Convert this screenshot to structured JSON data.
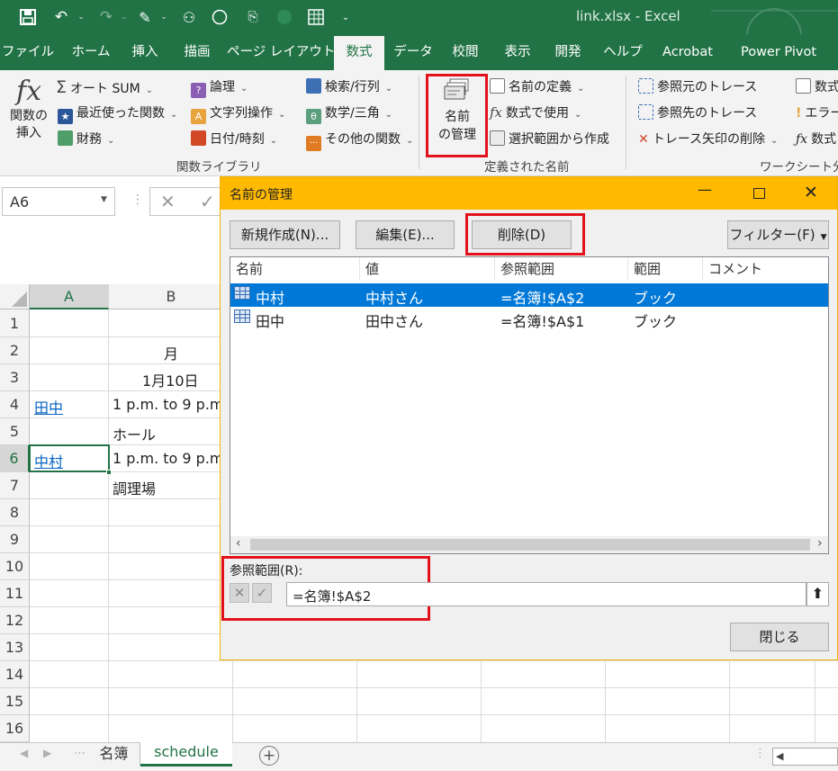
{
  "app": {
    "window_title": "link.xlsx  -  Excel"
  },
  "ribbon_tabs": [
    "ファイル",
    "ホーム",
    "挿入",
    "描画",
    "ページ レイアウト",
    "数式",
    "データ",
    "校閲",
    "表示",
    "開発",
    "ヘルプ",
    "Acrobat",
    "Power Pivot"
  ],
  "active_tab": "数式",
  "ribbon": {
    "insert_function": {
      "line1": "関数の",
      "line2": "挿入"
    },
    "col1": [
      "オート SUM",
      "最近使った関数",
      "財務"
    ],
    "col2": [
      "論理",
      "文字列操作",
      "日付/時刻"
    ],
    "col3": [
      "検索/行列",
      "数学/三角",
      "その他の関数"
    ],
    "function_library_label": "関数ライブラリ",
    "name_manager": {
      "line1": "名前",
      "line2": "の管理"
    },
    "defined_names": [
      "名前の定義",
      "数式で使用",
      "選択範囲から作成"
    ],
    "defined_names_label": "定義された名前",
    "auditing": [
      "参照元のトレース",
      "参照先のトレース",
      "トレース矢印の削除"
    ],
    "auditing_right": [
      "数式",
      "エラー",
      "数式"
    ],
    "auditing_label": "ワークシート分析"
  },
  "formula_bar": {
    "name_box": "A6"
  },
  "grid": {
    "columns": [
      "A",
      "B"
    ],
    "rows": [
      "1",
      "2",
      "3",
      "4",
      "5",
      "6",
      "7",
      "8",
      "9",
      "10",
      "11",
      "12",
      "13",
      "14",
      "15",
      "16"
    ],
    "cells": {
      "B2": "月",
      "B3": "1月10日",
      "A4": "田中",
      "B4": "1 p.m. to 9 p.m",
      "B5": "ホール",
      "A6": "中村",
      "B6": "1 p.m. to 9 p.m",
      "B7": "調理場"
    }
  },
  "sheet_tabs": [
    "名簿",
    "schedule"
  ],
  "active_sheet": "schedule",
  "dialog": {
    "title": "名前の管理",
    "buttons": {
      "new": "新規作成(N)...",
      "edit": "編集(E)...",
      "delete": "削除(D)",
      "filter": "フィルター(F)",
      "close": "閉じる"
    },
    "columns": [
      "名前",
      "値",
      "参照範囲",
      "範囲",
      "コメント"
    ],
    "rows": [
      {
        "name": "中村",
        "value": "中村さん",
        "refers_to": "=名簿!$A$2",
        "scope": "ブック",
        "comment": "",
        "selected": true
      },
      {
        "name": "田中",
        "value": "田中さん",
        "refers_to": "=名簿!$A$1",
        "scope": "ブック",
        "comment": "",
        "selected": false
      }
    ],
    "refers_to_label": "参照範囲(R):",
    "refers_to_value": "=名簿!$A$2"
  },
  "colors": {
    "excel_green": "#217346",
    "dialog_title": "#ffb900",
    "selection_blue": "#0078d7",
    "highlight_red": "#e3111b",
    "link_blue": "#0563c1"
  }
}
